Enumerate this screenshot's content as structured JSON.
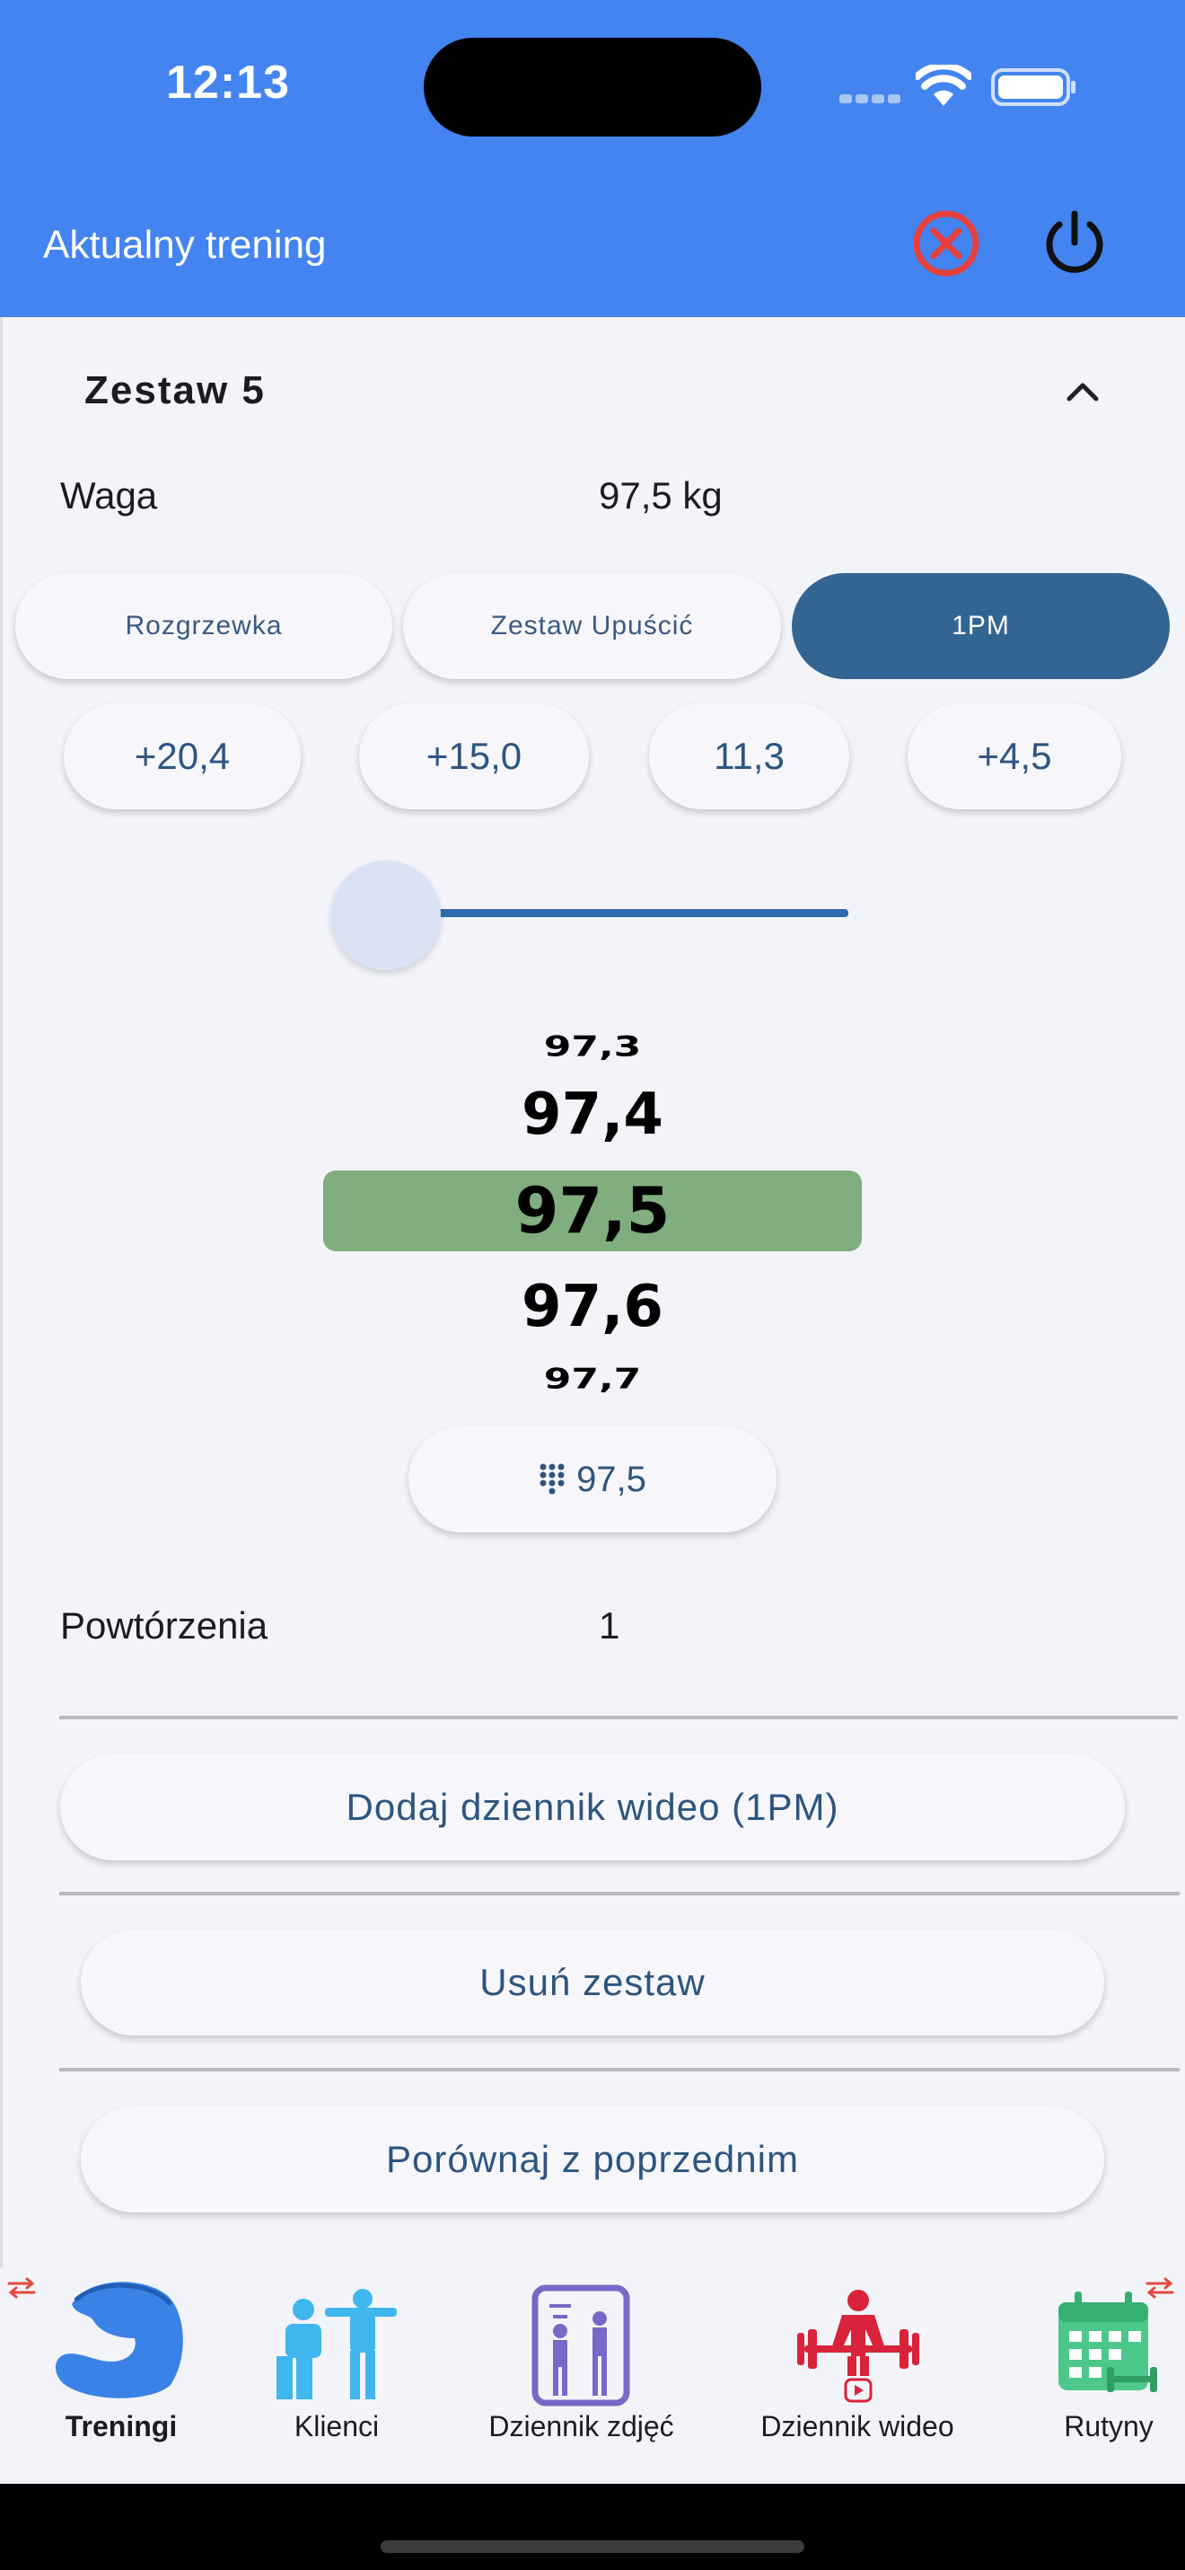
{
  "status_bar": {
    "time": "12:13"
  },
  "header": {
    "title": "Aktualny trening"
  },
  "set": {
    "title": "Zestaw 5"
  },
  "weight": {
    "label": "Waga",
    "value": "97,5 kg"
  },
  "set_types": [
    {
      "label": "Rozgrzewka",
      "active": false
    },
    {
      "label": "Zestaw Upuścić",
      "active": false
    },
    {
      "label": "1PM",
      "active": true
    }
  ],
  "increments": [
    "+20,4",
    "+15,0",
    "11,3",
    "+4,5"
  ],
  "slider": {
    "level": 0.0
  },
  "picker": {
    "values": [
      "97,3",
      "97,4",
      "97,5",
      "97,6",
      "97,7"
    ],
    "selected": "97,5"
  },
  "keypad_button": {
    "value": "97,5"
  },
  "reps": {
    "label": "Powtórzenia",
    "value": "1"
  },
  "actions": {
    "add_video": "Dodaj dziennik wideo (1PM)",
    "delete_set": "Usuń zestaw",
    "compare": "Porównaj z poprzednim"
  },
  "bottom_nav": [
    {
      "label": "Treningi",
      "icon": "biceps-icon",
      "active": true
    },
    {
      "label": "Klienci",
      "icon": "trainer-client-icon",
      "active": false
    },
    {
      "label": "Dziennik zdjęć",
      "icon": "mirror-photo-icon",
      "active": false
    },
    {
      "label": "Dziennik wideo",
      "icon": "weightlifter-video-icon",
      "active": false
    },
    {
      "label": "Rutyny",
      "icon": "calendar-dumbbell-icon",
      "active": false
    }
  ],
  "colors": {
    "header": "#4384f0",
    "active_pill": "#336593",
    "picker_highlight": "#80ae7e",
    "button_text": "#2e5581",
    "cancel_red": "#e5403b"
  }
}
